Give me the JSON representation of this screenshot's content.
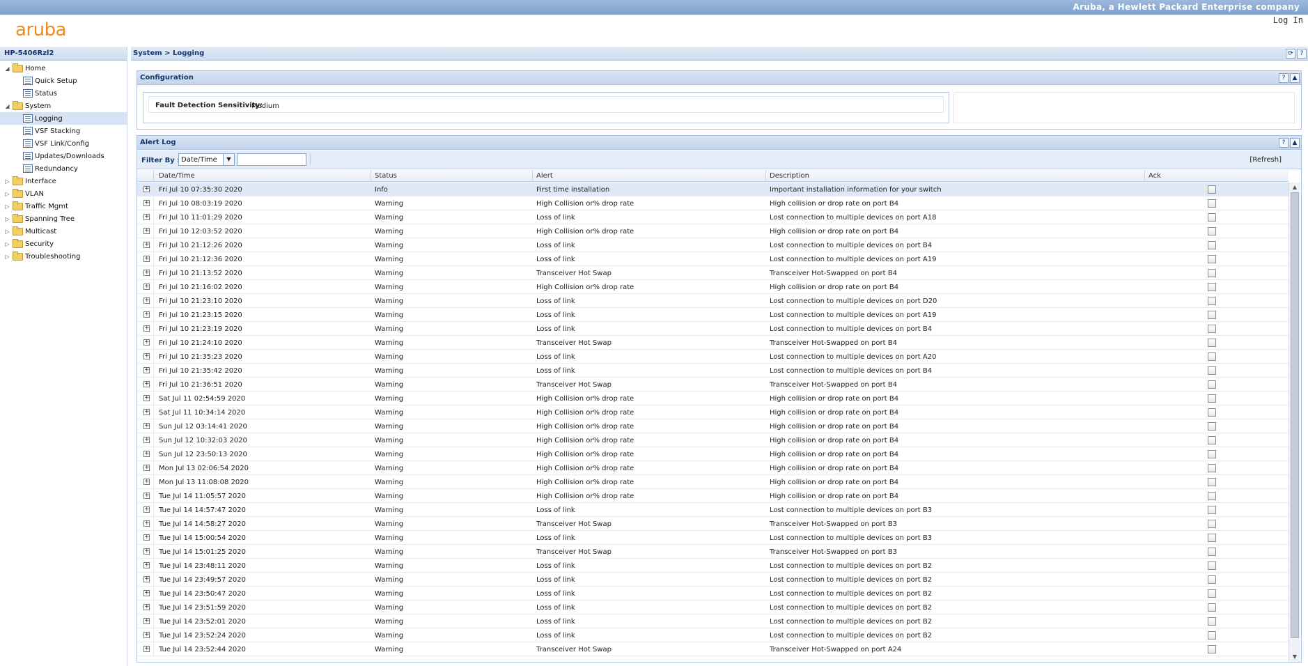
{
  "header": {
    "company": "Aruba, a Hewlett Packard Enterprise company",
    "login_label": "Log In",
    "logo_text": "aruba"
  },
  "nav": {
    "device": "HP-5406Rzl2",
    "items": [
      {
        "label": "Home",
        "type": "folder",
        "level": 0,
        "expanded": true
      },
      {
        "label": "Quick Setup",
        "type": "page",
        "level": 1
      },
      {
        "label": "Status",
        "type": "page",
        "level": 1
      },
      {
        "label": "System",
        "type": "folder",
        "level": 0,
        "expanded": true
      },
      {
        "label": "Logging",
        "type": "page",
        "level": 1,
        "selected": true
      },
      {
        "label": "VSF Stacking",
        "type": "page",
        "level": 1
      },
      {
        "label": "VSF Link/Config",
        "type": "page",
        "level": 1
      },
      {
        "label": "Updates/Downloads",
        "type": "page",
        "level": 1
      },
      {
        "label": "Redundancy",
        "type": "page",
        "level": 1
      },
      {
        "label": "Interface",
        "type": "folder",
        "level": 0
      },
      {
        "label": "VLAN",
        "type": "folder",
        "level": 0
      },
      {
        "label": "Traffic Mgmt",
        "type": "folder",
        "level": 0
      },
      {
        "label": "Spanning Tree",
        "type": "folder",
        "level": 0
      },
      {
        "label": "Multicast",
        "type": "folder",
        "level": 0
      },
      {
        "label": "Security",
        "type": "folder",
        "level": 0
      },
      {
        "label": "Troubleshooting",
        "type": "folder",
        "level": 0
      }
    ]
  },
  "breadcrumb": "System > Logging",
  "configuration": {
    "title": "Configuration",
    "label": "Fault Detection Sensitivity:",
    "value": "Medium"
  },
  "alert_log": {
    "title": "Alert Log",
    "filter_label": "Filter By :",
    "filter_selected": "Date/Time",
    "filter_input": "",
    "refresh_label": "[Refresh]",
    "columns": [
      "Date/Time",
      "Status",
      "Alert",
      "Description",
      "Ack"
    ],
    "rows": [
      [
        "Fri Jul 10 07:35:30 2020",
        "Info",
        "First time installation",
        "Important installation information for your switch"
      ],
      [
        "Fri Jul 10 08:03:19 2020",
        "Warning",
        "High Collision or% drop rate",
        "High collision or drop rate on port B4"
      ],
      [
        "Fri Jul 10 11:01:29 2020",
        "Warning",
        "Loss of link",
        "Lost connection to multiple devices on port A18"
      ],
      [
        "Fri Jul 10 12:03:52 2020",
        "Warning",
        "High Collision or% drop rate",
        "High collision or drop rate on port B4"
      ],
      [
        "Fri Jul 10 21:12:26 2020",
        "Warning",
        "Loss of link",
        "Lost connection to multiple devices on port B4"
      ],
      [
        "Fri Jul 10 21:12:36 2020",
        "Warning",
        "Loss of link",
        "Lost connection to multiple devices on port A19"
      ],
      [
        "Fri Jul 10 21:13:52 2020",
        "Warning",
        "Transceiver Hot Swap",
        "Transceiver Hot-Swapped on port B4"
      ],
      [
        "Fri Jul 10 21:16:02 2020",
        "Warning",
        "High Collision or% drop rate",
        "High collision or drop rate on port B4"
      ],
      [
        "Fri Jul 10 21:23:10 2020",
        "Warning",
        "Loss of link",
        "Lost connection to multiple devices on port D20"
      ],
      [
        "Fri Jul 10 21:23:15 2020",
        "Warning",
        "Loss of link",
        "Lost connection to multiple devices on port A19"
      ],
      [
        "Fri Jul 10 21:23:19 2020",
        "Warning",
        "Loss of link",
        "Lost connection to multiple devices on port B4"
      ],
      [
        "Fri Jul 10 21:24:10 2020",
        "Warning",
        "Transceiver Hot Swap",
        "Transceiver Hot-Swapped on port B4"
      ],
      [
        "Fri Jul 10 21:35:23 2020",
        "Warning",
        "Loss of link",
        "Lost connection to multiple devices on port A20"
      ],
      [
        "Fri Jul 10 21:35:42 2020",
        "Warning",
        "Loss of link",
        "Lost connection to multiple devices on port B4"
      ],
      [
        "Fri Jul 10 21:36:51 2020",
        "Warning",
        "Transceiver Hot Swap",
        "Transceiver Hot-Swapped on port B4"
      ],
      [
        "Sat Jul 11 02:54:59 2020",
        "Warning",
        "High Collision or% drop rate",
        "High collision or drop rate on port B4"
      ],
      [
        "Sat Jul 11 10:34:14 2020",
        "Warning",
        "High Collision or% drop rate",
        "High collision or drop rate on port B4"
      ],
      [
        "Sun Jul 12 03:14:41 2020",
        "Warning",
        "High Collision or% drop rate",
        "High collision or drop rate on port B4"
      ],
      [
        "Sun Jul 12 10:32:03 2020",
        "Warning",
        "High Collision or% drop rate",
        "High collision or drop rate on port B4"
      ],
      [
        "Sun Jul 12 23:50:13 2020",
        "Warning",
        "High Collision or% drop rate",
        "High collision or drop rate on port B4"
      ],
      [
        "Mon Jul 13 02:06:54 2020",
        "Warning",
        "High Collision or% drop rate",
        "High collision or drop rate on port B4"
      ],
      [
        "Mon Jul 13 11:08:08 2020",
        "Warning",
        "High Collision or% drop rate",
        "High collision or drop rate on port B4"
      ],
      [
        "Tue Jul 14 11:05:57 2020",
        "Warning",
        "High Collision or% drop rate",
        "High collision or drop rate on port B4"
      ],
      [
        "Tue Jul 14 14:57:47 2020",
        "Warning",
        "Loss of link",
        "Lost connection to multiple devices on port B3"
      ],
      [
        "Tue Jul 14 14:58:27 2020",
        "Warning",
        "Transceiver Hot Swap",
        "Transceiver Hot-Swapped on port B3"
      ],
      [
        "Tue Jul 14 15:00:54 2020",
        "Warning",
        "Loss of link",
        "Lost connection to multiple devices on port B3"
      ],
      [
        "Tue Jul 14 15:01:25 2020",
        "Warning",
        "Transceiver Hot Swap",
        "Transceiver Hot-Swapped on port B3"
      ],
      [
        "Tue Jul 14 23:48:11 2020",
        "Warning",
        "Loss of link",
        "Lost connection to multiple devices on port B2"
      ],
      [
        "Tue Jul 14 23:49:57 2020",
        "Warning",
        "Loss of link",
        "Lost connection to multiple devices on port B2"
      ],
      [
        "Tue Jul 14 23:50:47 2020",
        "Warning",
        "Loss of link",
        "Lost connection to multiple devices on port B2"
      ],
      [
        "Tue Jul 14 23:51:59 2020",
        "Warning",
        "Loss of link",
        "Lost connection to multiple devices on port B2"
      ],
      [
        "Tue Jul 14 23:52:01 2020",
        "Warning",
        "Loss of link",
        "Lost connection to multiple devices on port B2"
      ],
      [
        "Tue Jul 14 23:52:24 2020",
        "Warning",
        "Loss of link",
        "Lost connection to multiple devices on port B2"
      ],
      [
        "Tue Jul 14 23:52:44 2020",
        "Warning",
        "Transceiver Hot Swap",
        "Transceiver Hot-Swapped on port A24"
      ]
    ]
  },
  "icons": {
    "refresh": "refresh-icon",
    "help": "help-icon",
    "collapse": "collapse-icon",
    "expand_row": "expand-row-icon"
  },
  "colors": {
    "accent": "#f08a24",
    "header_text": "#16356b",
    "banner": "#8fabd4"
  }
}
